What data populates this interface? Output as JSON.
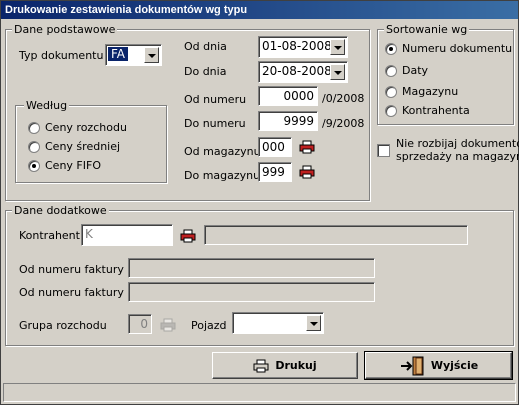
{
  "window": {
    "title": "Drukowanie zestawienia dokumentów wg typu"
  },
  "basic": {
    "title": "Dane podstawowe",
    "doc_type_label": "Typ dokumentu",
    "doc_type_value": "FA",
    "method": {
      "title": "Według",
      "options": [
        "Ceny rozchodu",
        "Ceny średniej",
        "Ceny FIFO"
      ],
      "selected": "Ceny FIFO"
    },
    "from_date_label": "Od dnia",
    "from_date_value": "01-08-2008",
    "to_date_label": "Do dnia",
    "to_date_value": "20-08-2008",
    "from_number_label": "Od numeru",
    "from_number_value": "0000",
    "from_number_suffix": "/0/2008",
    "to_number_label": "Do numeru",
    "to_number_value": "9999",
    "to_number_suffix": "/9/2008",
    "from_warehouse_label": "Od magazynu",
    "from_warehouse_value": "000",
    "to_warehouse_label": "Do magazynu",
    "to_warehouse_value": "999"
  },
  "sort": {
    "title": "Sortowanie wg",
    "options": [
      "Numeru dokumentu",
      "Daty",
      "Magazynu",
      "Kontrahenta"
    ],
    "selected": "Numeru dokumentu"
  },
  "no_split": {
    "label_line1": "Nie rozbijaj dokumentów",
    "label_line2": "sprzedaży na magazyny",
    "checked": false
  },
  "extra": {
    "title": "Dane dodatkowe",
    "contractor_label": "Kontrahent",
    "contractor_value": "K",
    "invoice_from_label": "Od numeru faktury",
    "invoice_to_label": "Od numeru faktury",
    "dispatch_group_label": "Grupa rozchodu",
    "dispatch_group_value": "0",
    "vehicle_label": "Pojazd",
    "vehicle_value": ""
  },
  "buttons": {
    "print": "Drukuj",
    "exit": "Wyjście"
  },
  "colors": {
    "titlebar_start": "#0a246a",
    "titlebar_end": "#3a6ea5",
    "face": "#d4d0c8",
    "selection": "#0a246a",
    "printer_red": "#c02020"
  }
}
